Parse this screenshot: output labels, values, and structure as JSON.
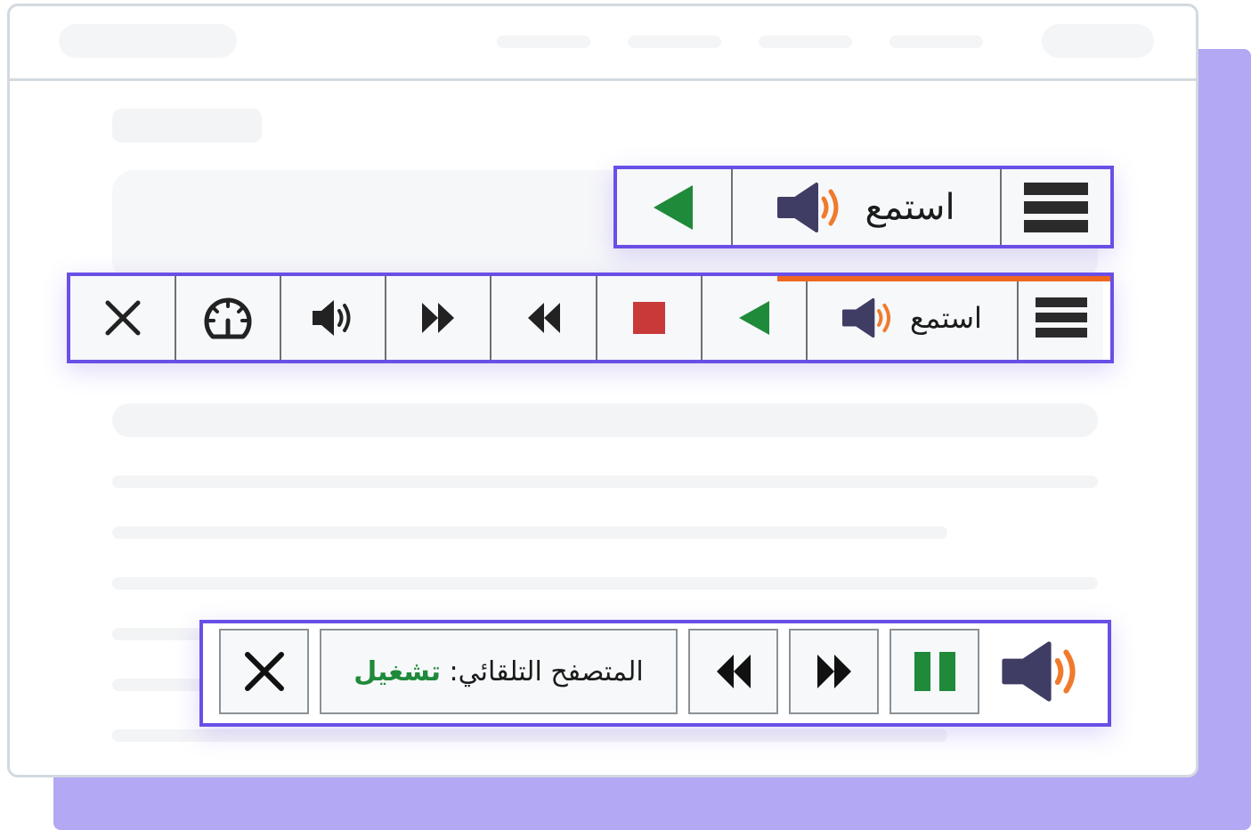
{
  "player_collapsed": {
    "listen_label": "استمع",
    "icons": {
      "menu": "menu-icon",
      "speaker": "speaker-icon",
      "play": "play-icon"
    }
  },
  "player_expanded": {
    "listen_label": "استمع",
    "progress_fraction": 0.32,
    "icons": {
      "menu": "menu-icon",
      "speaker": "speaker-icon",
      "play": "play-icon",
      "stop": "stop-icon",
      "rewind": "rewind-icon",
      "forward": "fast-forward-icon",
      "volume": "volume-icon",
      "speed": "speedometer-icon",
      "close": "close-icon"
    }
  },
  "player_autoscroll": {
    "status_label": "المتصفح التلقائي:",
    "status_value": "تشغيل",
    "icons": {
      "speaker": "speaker-icon",
      "pause": "pause-icon",
      "forward": "fast-forward-icon",
      "rewind": "rewind-icon",
      "close": "close-icon"
    }
  },
  "colors": {
    "accent": "#6a4fe6",
    "play_green": "#1f8a3a",
    "stop_red": "#c9393a",
    "speaker_body": "#3f3d63",
    "speaker_waves": "#f07a2c",
    "progress_orange": "#f0661e",
    "backdrop": "#b3a8f4"
  }
}
